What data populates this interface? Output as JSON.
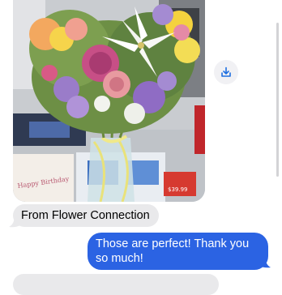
{
  "conversation": {
    "attachment": {
      "image_subject": "flower-bouquet-photo",
      "card_text": "Happy Birthday",
      "price_tag": "$39.99"
    },
    "messages": [
      {
        "direction": "incoming",
        "text": "From Flower Connection"
      },
      {
        "direction": "outgoing",
        "text": "Those are perfect! Thank you so much!"
      }
    ]
  },
  "icons": {
    "save": "save-to-downloads-icon"
  },
  "colors": {
    "incoming_bubble": "#e9e9eb",
    "outgoing_bubble": "#2b63e3",
    "icon_accent": "#1e6fe0"
  }
}
